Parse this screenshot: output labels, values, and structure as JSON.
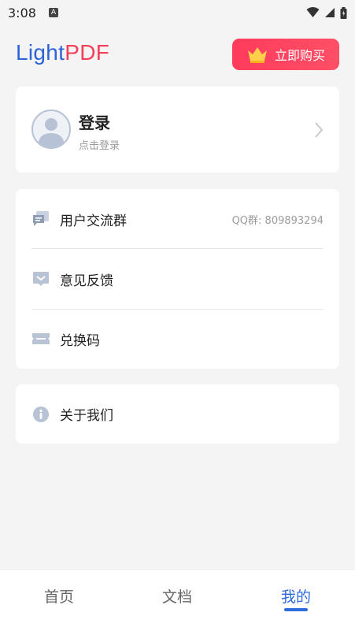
{
  "status_bar": {
    "time": "3:08",
    "badge": "A",
    "icons": [
      "wifi-icon",
      "signal-icon",
      "battery-icon"
    ]
  },
  "header": {
    "logo_light": "Light",
    "logo_pdf": "PDF",
    "buy_button": "立即购买"
  },
  "login": {
    "title": "登录",
    "subtitle": "点击登录"
  },
  "menu": {
    "items": [
      {
        "label": "用户交流群",
        "extra": "QQ群: 809893294",
        "icon": "chat-icon"
      },
      {
        "label": "意见反馈",
        "extra": "",
        "icon": "feedback-icon"
      },
      {
        "label": "兑换码",
        "extra": "",
        "icon": "ticket-icon"
      }
    ]
  },
  "about": {
    "label": "关于我们",
    "icon": "info-icon"
  },
  "bottom_nav": {
    "tabs": [
      "首页",
      "文档",
      "我的"
    ],
    "active": "我的"
  },
  "colors": {
    "brand_blue": "#2c64d8",
    "brand_red": "#f2405a",
    "icon_gray": "#b9c3d6",
    "background": "#f4f4f4"
  }
}
